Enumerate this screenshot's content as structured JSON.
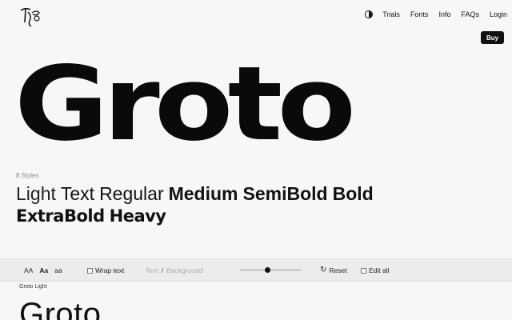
{
  "nav": {
    "theme_icon": "contrast-icon",
    "links": [
      "Trials",
      "Fonts",
      "Info",
      "FAQs",
      "Login"
    ],
    "buy_label": "Buy"
  },
  "hero": {
    "title": "Groto"
  },
  "styles": {
    "count": "8 Styles",
    "items": [
      "Light",
      "Text",
      "Regular",
      "Medium",
      "SemiBold",
      "Bold",
      "ExtraBold",
      "Heavy"
    ]
  },
  "toolbar": {
    "case_options": [
      "AA",
      "Aa",
      "aa"
    ],
    "wrap_label": "Wrap text",
    "text_label": "Text",
    "separator": "/",
    "background_label": "Background",
    "slider_level": 0.45,
    "reset_label": "Reset",
    "edit_all_label": "Edit all"
  },
  "specimen": {
    "label": "Groto Light",
    "text": "Groto"
  },
  "colors": {
    "buy_bg": "#111111",
    "buy_fg": "#ffffff",
    "page_bg": "#f7f7f7",
    "toolbar_bg": "#ececec"
  }
}
